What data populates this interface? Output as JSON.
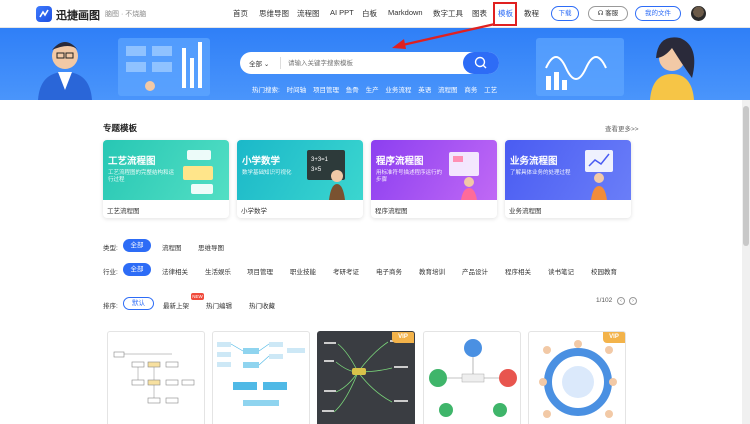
{
  "header": {
    "brand": "迅捷画图",
    "slogan": "脑图 · 不烧脑",
    "nav": [
      "首页",
      "思维导图",
      "流程图",
      "AI PPT",
      "白板",
      "Markdown",
      "数字工具",
      "图表",
      "模板",
      "教程"
    ],
    "active_nav": "模板",
    "download_label": "下载",
    "client_label": "客服",
    "files_label": "我的文件"
  },
  "banner": {
    "search_scope": "全部",
    "search_placeholder": "请输入关键字搜索模板",
    "hot_label": "热门搜索:",
    "hot_terms": [
      "时间轴",
      "项目管理",
      "鱼骨",
      "生产",
      "业务流程",
      "英语",
      "流程图",
      "商务",
      "工艺"
    ]
  },
  "topics": {
    "title": "专题模板",
    "view_more": "查看更多>>",
    "cards": [
      {
        "title": "工艺流程图",
        "subtitle": "工艺流程图的完整结构和运行过程",
        "label": "工艺流程图",
        "color1": "#27c7b4",
        "color2": "#53dfc4"
      },
      {
        "title": "小学数学",
        "subtitle": "数学基础知识可视化",
        "label": "小学数学",
        "color1": "#1bb8c9",
        "color2": "#3bd6cf"
      },
      {
        "title": "程序流程图",
        "subtitle": "用标准符号描述程序运行的步骤",
        "label": "程序流程图",
        "color1": "#8c3ff0",
        "color2": "#c069f5"
      },
      {
        "title": "业务流程图",
        "subtitle": "了解具体业务的处理过程",
        "label": "业务流程图",
        "color1": "#4a5cf2",
        "color2": "#6a7ef8"
      }
    ]
  },
  "filters": {
    "type_label": "类型:",
    "types": [
      "全部",
      "流程图",
      "思维导图"
    ],
    "industry_label": "行业:",
    "industries": [
      "全部",
      "法律相关",
      "生活娱乐",
      "项目管理",
      "职业技能",
      "考研考证",
      "电子商务",
      "教育培训",
      "产品设计",
      "程序相关",
      "读书笔记",
      "校园教育"
    ],
    "sort_label": "排序:",
    "sorts": [
      "默认",
      "最新上架",
      "热门编辑",
      "热门收藏"
    ],
    "new_badge": "NEW",
    "page_indicator": "1/102"
  },
  "templates": [
    {
      "vip": false,
      "style": "light-flow"
    },
    {
      "vip": false,
      "style": "light-mind"
    },
    {
      "vip": true,
      "style": "dark-mind"
    },
    {
      "vip": false,
      "style": "circle"
    },
    {
      "vip": true,
      "style": "ring"
    }
  ],
  "vip_label": "VIP",
  "colors": {
    "accent": "#2d6cf6",
    "banner": "#3b88f9",
    "highlight_box": "#e02020"
  }
}
